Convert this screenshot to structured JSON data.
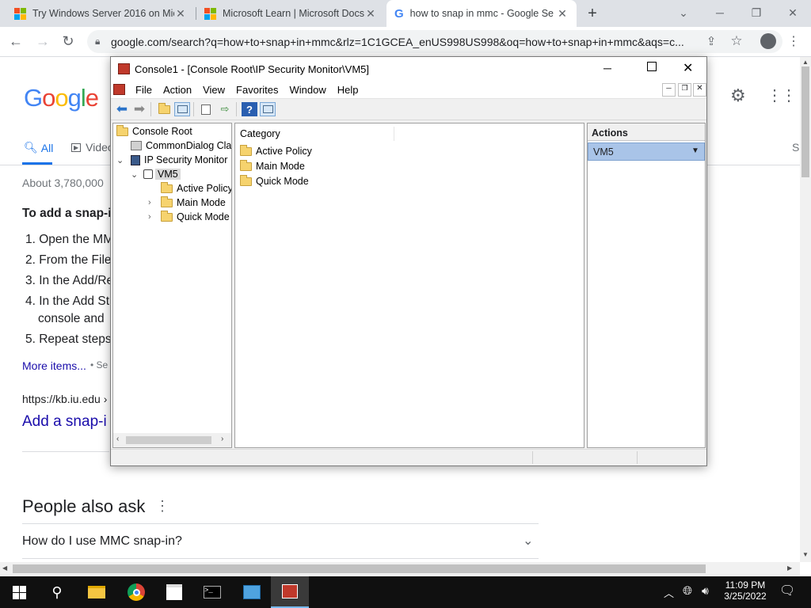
{
  "browser": {
    "tabs": [
      {
        "title": "Try Windows Server 2016 on Mic",
        "close": "✕"
      },
      {
        "title": "Microsoft Learn | Microsoft Docs",
        "close": "✕"
      },
      {
        "title": "how to snap in mmc - Google Se",
        "close": "✕"
      }
    ],
    "new_tab": "+",
    "url": "google.com/search?q=how+to+snap+in+mmc&rlz=1C1GCEA_enUS998US998&oq=how+to+snap+in+mmc&aqs=c..."
  },
  "google": {
    "logo": "Google",
    "tabs": {
      "all": "All",
      "videos": "Videos"
    },
    "result_count": "About 3,780,000",
    "featured_heading": "To add a snap-in",
    "steps": [
      "1. Open the MM",
      "2. From the File",
      "3. In the Add/Re",
      "4. In the Add St",
      "console and",
      "5. Repeat steps"
    ],
    "more_items": "More items...",
    "more_items_tail": "• Se",
    "source_url": "https://kb.iu.edu ›",
    "result_title": "Add a snap-i",
    "people_also_ask": "People also ask",
    "question_1": "How do I use MMC snap-in?",
    "right_edge_letter": "S"
  },
  "mmc": {
    "title": "Console1 - [Console Root\\IP Security Monitor\\VM5]",
    "menu": [
      "File",
      "Action",
      "View",
      "Favorites",
      "Window",
      "Help"
    ],
    "tree": {
      "root": "Console Root",
      "commondialog": "CommonDialog Cla",
      "ipsec": "IP Security Monitor",
      "vm5": "VM5",
      "active_policy": "Active Policy",
      "main_mode": "Main Mode",
      "quick_mode": "Quick Mode"
    },
    "list": {
      "column": "Category",
      "items": [
        "Active Policy",
        "Main Mode",
        "Quick Mode"
      ]
    },
    "actions": {
      "header": "Actions",
      "selected": "VM5"
    }
  },
  "taskbar": {
    "time": "11:09 PM",
    "date": "3/25/2022"
  }
}
